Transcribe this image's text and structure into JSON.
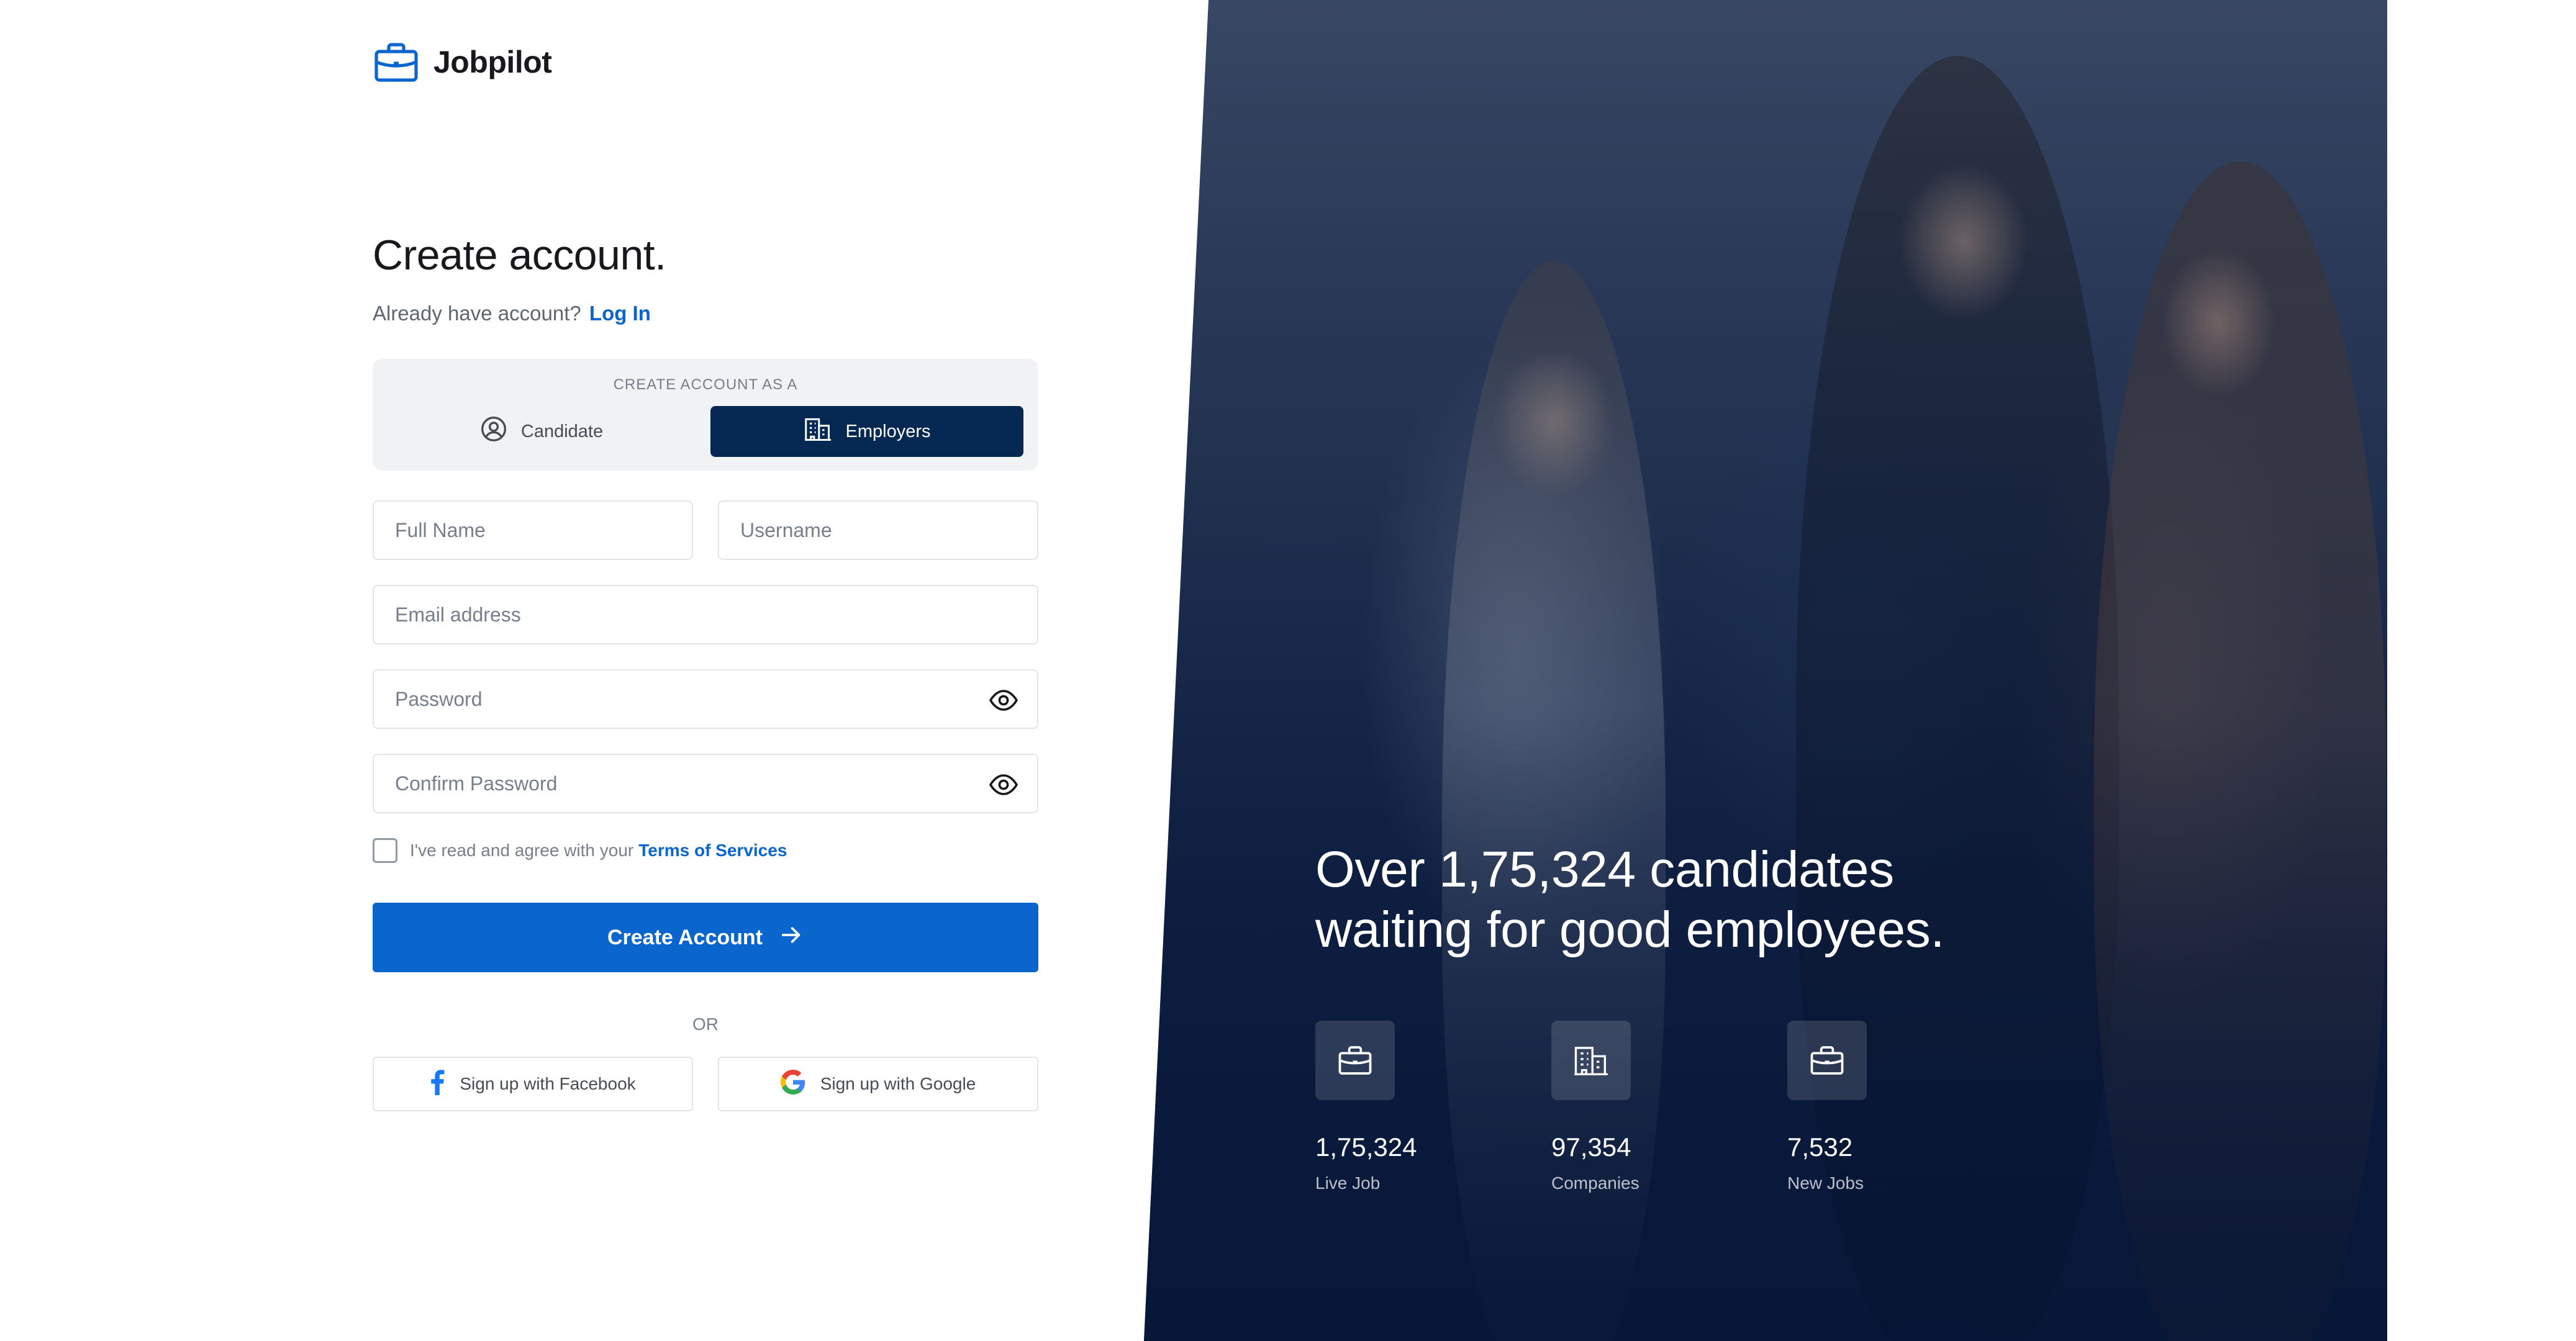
{
  "brand": {
    "name": "Jobpilot"
  },
  "form": {
    "title": "Create account.",
    "login_prompt": "Already have account?",
    "login_link": "Log In",
    "account_type": {
      "label": "CREATE ACCOUNT AS A",
      "options": [
        {
          "label": "Candidate",
          "selected": false
        },
        {
          "label": "Employers",
          "selected": true
        }
      ]
    },
    "fields": {
      "full_name": {
        "placeholder": "Full Name",
        "value": ""
      },
      "username": {
        "placeholder": "Username",
        "value": ""
      },
      "email": {
        "placeholder": "Email address",
        "value": ""
      },
      "password": {
        "placeholder": "Password",
        "value": ""
      },
      "confirm_password": {
        "placeholder": "Confirm Password",
        "value": ""
      }
    },
    "terms": {
      "text": "I've read and agree with your",
      "link": "Terms of Services",
      "checked": false
    },
    "submit_label": "Create Account",
    "divider": "OR",
    "social": {
      "facebook": "Sign up with Facebook",
      "google": "Sign up with Google"
    }
  },
  "hero": {
    "headline_line1": "Over 1,75,324 candidates",
    "headline_line2": "waiting for good employees.",
    "stats": [
      {
        "value": "1,75,324",
        "label": "Live Job",
        "icon": "briefcase-icon"
      },
      {
        "value": "97,354",
        "label": "Companies",
        "icon": "buildings-icon"
      },
      {
        "value": "7,532",
        "label": "New Jobs",
        "icon": "briefcase-icon"
      }
    ]
  },
  "colors": {
    "primary": "#0a65cc",
    "selected_tab": "#042852",
    "hero_overlay": "#0e1f3f",
    "text_dark": "#18191c",
    "text_muted": "#767f8c"
  }
}
